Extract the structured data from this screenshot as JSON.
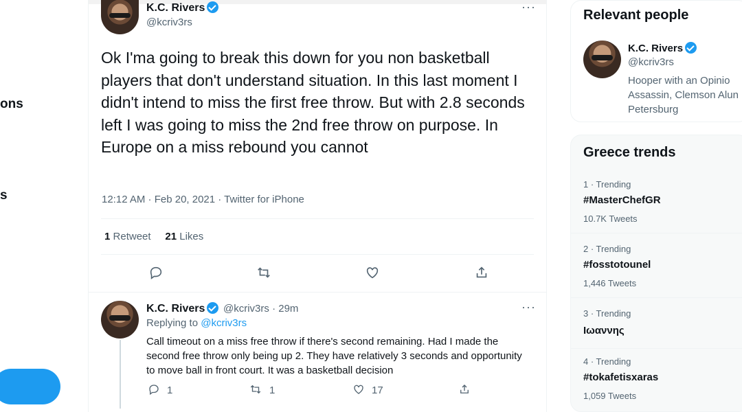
{
  "left_nav": {
    "fragment_1": "ons",
    "fragment_2": "s"
  },
  "main_tweet": {
    "author_name": "K.C. Rivers",
    "author_handle": "@kcriv3rs",
    "text": "Ok I'ma going to break this down for you non basketball players that don't understand situation. In this last moment I didn't intend to miss the first free throw. But with 2.8 seconds left I was going to miss the 2nd free throw on purpose. In Europe on a miss rebound you cannot",
    "timestamp": "12:12 AM · Feb 20, 2021 · Twitter for iPhone",
    "retweets_count": "1",
    "retweets_label": "Retweet",
    "likes_count": "21",
    "likes_label": "Likes",
    "more": "···"
  },
  "reply_tweet": {
    "author_name": "K.C. Rivers",
    "author_handle": "@kcriv3rs",
    "time": "· 29m",
    "replying_prefix": "Replying to",
    "replying_to": "@kcriv3rs",
    "text": "Call timeout on a miss free throw if there's second remaining. Had I made the second free throw only being up 2. They have relatively 3 seconds and opportunity to move ball in front court. It was a basketball decision",
    "replies": "1",
    "retweets": "1",
    "likes": "17",
    "more": "···"
  },
  "relevant_people": {
    "title": "Relevant people",
    "name": "K.C. Rivers",
    "handle": "@kcriv3rs",
    "bio": "Hooper with an Opinio\nAssassin, Clemson Alun\nPetersburg"
  },
  "trends": {
    "title": "Greece trends",
    "items": [
      {
        "rank": "1 · Trending",
        "name": "#MasterChefGR",
        "count": "10.7K Tweets"
      },
      {
        "rank": "2 · Trending",
        "name": "#fosstotounel",
        "count": "1,446 Tweets"
      },
      {
        "rank": "3 · Trending",
        "name": "Ιωαννης",
        "count": ""
      },
      {
        "rank": "4 · Trending",
        "name": "#tokafetisxaras",
        "count": "1,059 Tweets"
      }
    ]
  },
  "icons": {
    "reply": "reply-icon",
    "retweet": "retweet-icon",
    "like": "heart-icon",
    "share": "share-icon",
    "verified": "verified-badge-icon"
  },
  "colors": {
    "accent": "#1d9bf0",
    "text": "#0f1419",
    "secondary": "#536471"
  }
}
